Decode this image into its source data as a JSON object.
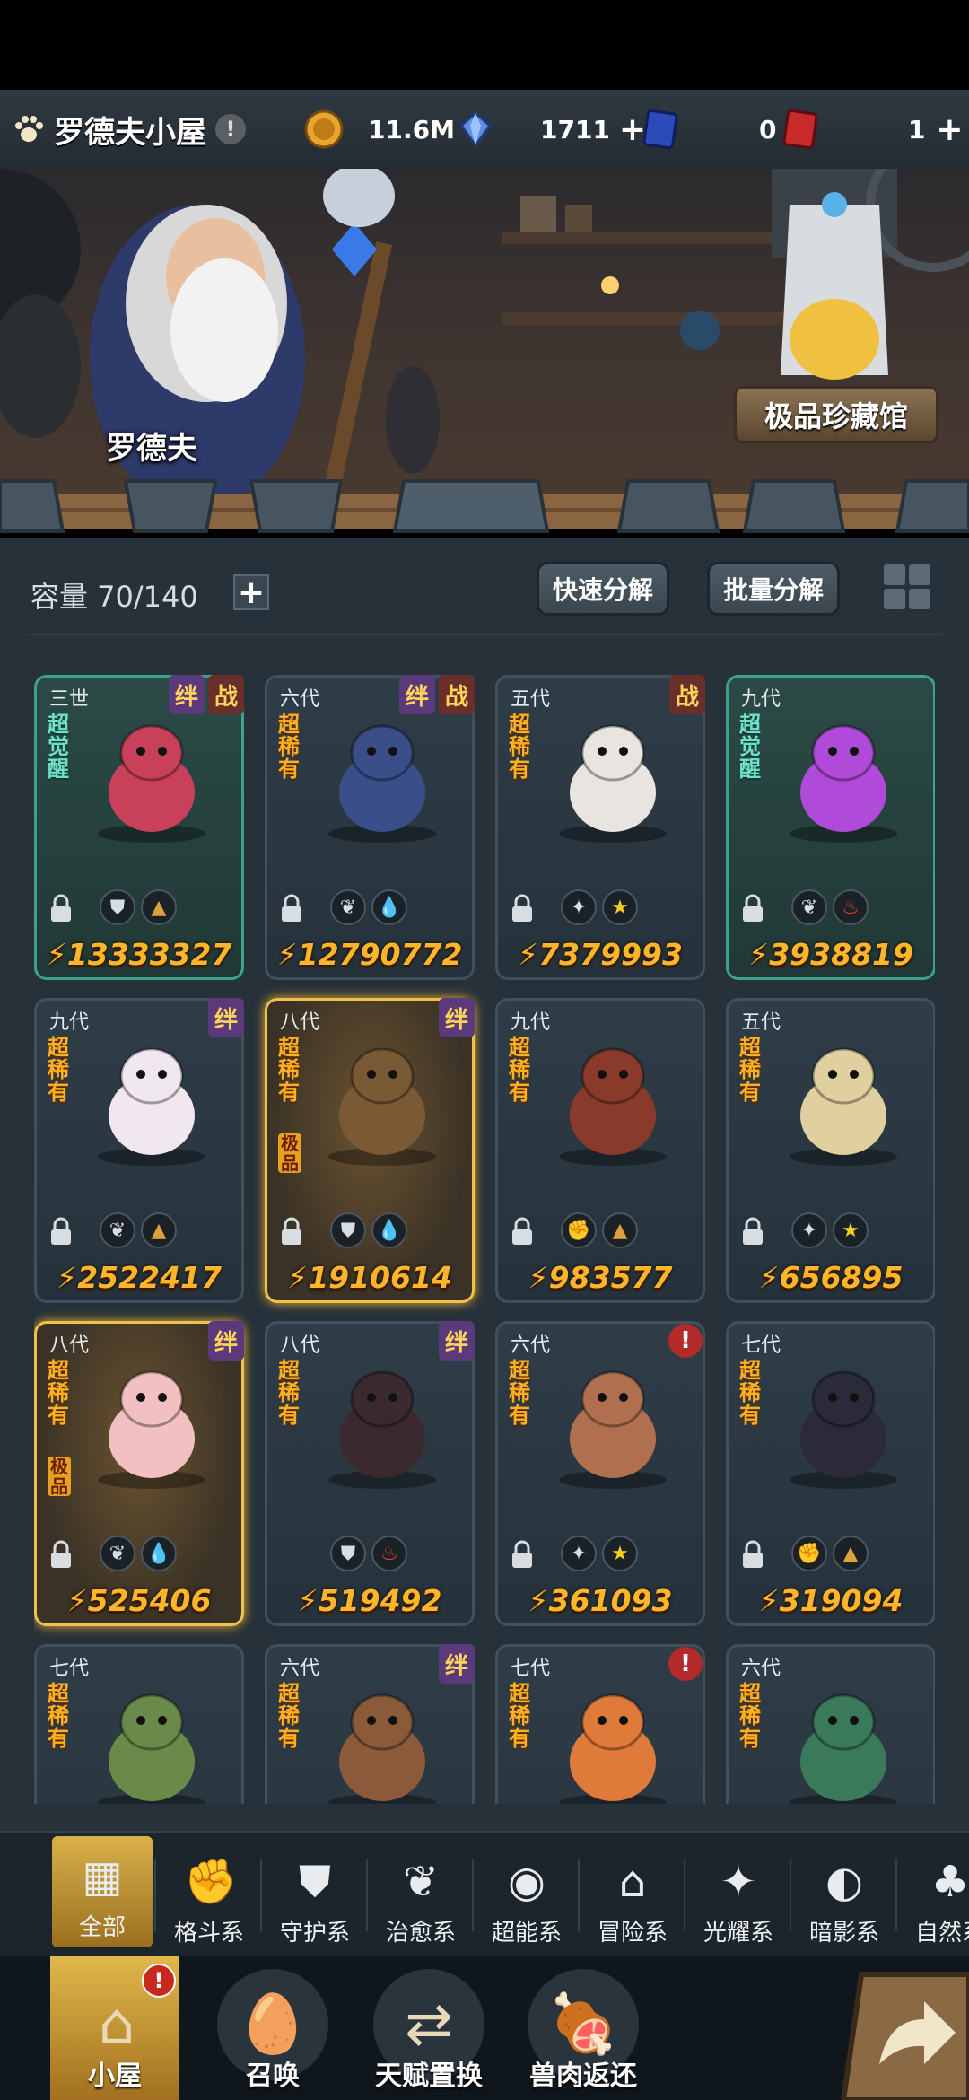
{
  "topbar": {
    "title": "罗德夫小屋",
    "warn": "!",
    "gold": "11.6M",
    "crystal": "1711",
    "ticket_a": "0",
    "ticket_b": "1",
    "plus": "+"
  },
  "scene": {
    "npc_name": "罗德夫",
    "gallery_label": "极品珍藏馆"
  },
  "storage": {
    "capacity_text": "容量 70/140",
    "plus": "+",
    "quick_decompose": "快速分解",
    "batch_decompose": "批量分解"
  },
  "pets": [
    {
      "gen": "三世",
      "rarity": "超觉醒",
      "premium": "",
      "tags": [
        "绊",
        "战"
      ],
      "elements": [
        "guard",
        "adventure"
      ],
      "power": "13333327",
      "style": "awaken",
      "alert": false,
      "locked": true,
      "color": "#c9405a"
    },
    {
      "gen": "六代",
      "rarity": "超稀有",
      "premium": "",
      "tags": [
        "绊",
        "战"
      ],
      "elements": [
        "heal",
        "water"
      ],
      "power": "12790772",
      "style": "normal",
      "alert": false,
      "locked": true,
      "color": "#3a4e8a"
    },
    {
      "gen": "五代",
      "rarity": "超稀有",
      "premium": "",
      "tags": [
        "战"
      ],
      "elements": [
        "light",
        "star"
      ],
      "power": "7379993",
      "style": "normal",
      "alert": false,
      "locked": true,
      "color": "#e8e4e0"
    },
    {
      "gen": "九代",
      "rarity": "超觉醒",
      "premium": "",
      "tags": [],
      "elements": [
        "heal",
        "fire"
      ],
      "power": "3938819",
      "style": "awaken",
      "alert": false,
      "locked": true,
      "color": "#b04ad8"
    },
    {
      "gen": "九代",
      "rarity": "超稀有",
      "premium": "",
      "tags": [
        "绊"
      ],
      "elements": [
        "heal",
        "adventure"
      ],
      "power": "2522417",
      "style": "normal",
      "alert": false,
      "locked": true,
      "color": "#f0e8ee"
    },
    {
      "gen": "八代",
      "rarity": "超稀有",
      "premium": "极品",
      "tags": [
        "绊"
      ],
      "elements": [
        "guard",
        "water"
      ],
      "power": "1910614",
      "style": "gold",
      "alert": false,
      "locked": true,
      "color": "#7a5a34"
    },
    {
      "gen": "九代",
      "rarity": "超稀有",
      "premium": "",
      "tags": [],
      "elements": [
        "fight",
        "adventure"
      ],
      "power": "983577",
      "style": "normal",
      "alert": false,
      "locked": true,
      "color": "#8a3a2a"
    },
    {
      "gen": "五代",
      "rarity": "超稀有",
      "premium": "",
      "tags": [],
      "elements": [
        "light",
        "star"
      ],
      "power": "656895",
      "style": "normal",
      "alert": false,
      "locked": true,
      "color": "#e0d0a0"
    },
    {
      "gen": "八代",
      "rarity": "超稀有",
      "premium": "极品",
      "tags": [
        "绊"
      ],
      "elements": [
        "heal",
        "water"
      ],
      "power": "525406",
      "style": "gold",
      "alert": false,
      "locked": true,
      "color": "#f2c0c0"
    },
    {
      "gen": "八代",
      "rarity": "超稀有",
      "premium": "",
      "tags": [
        "绊"
      ],
      "elements": [
        "guard",
        "fire"
      ],
      "power": "519492",
      "style": "normal",
      "alert": false,
      "locked": false,
      "color": "#3a2a30"
    },
    {
      "gen": "六代",
      "rarity": "超稀有",
      "premium": "",
      "tags": [],
      "elements": [
        "light",
        "star"
      ],
      "power": "361093",
      "style": "normal",
      "alert": true,
      "locked": true,
      "color": "#b07050"
    },
    {
      "gen": "七代",
      "rarity": "超稀有",
      "premium": "",
      "tags": [],
      "elements": [
        "fight",
        "adventure"
      ],
      "power": "319094",
      "style": "normal",
      "alert": false,
      "locked": true,
      "color": "#2a2a3a"
    },
    {
      "gen": "七代",
      "rarity": "超稀有",
      "premium": "",
      "tags": [],
      "elements": [],
      "power": "",
      "style": "normal",
      "alert": false,
      "locked": false,
      "color": "#6a8a4a"
    },
    {
      "gen": "六代",
      "rarity": "超稀有",
      "premium": "",
      "tags": [
        "绊"
      ],
      "elements": [],
      "power": "",
      "style": "normal",
      "alert": false,
      "locked": false,
      "color": "#8a5a3a"
    },
    {
      "gen": "七代",
      "rarity": "超稀有",
      "premium": "",
      "tags": [],
      "elements": [],
      "power": "",
      "style": "normal",
      "alert": true,
      "locked": false,
      "color": "#e07a3a"
    },
    {
      "gen": "六代",
      "rarity": "超稀有",
      "premium": "",
      "tags": [],
      "elements": [],
      "power": "",
      "style": "normal",
      "alert": false,
      "locked": false,
      "color": "#3a7a5a"
    }
  ],
  "alert_mark": "!",
  "categories": [
    {
      "label": "全部",
      "icon": "all-icon"
    },
    {
      "label": "格斗系",
      "icon": "fist-icon"
    },
    {
      "label": "守护系",
      "icon": "shield-icon"
    },
    {
      "label": "治愈系",
      "icon": "sprout-icon"
    },
    {
      "label": "超能系",
      "icon": "psychic-icon"
    },
    {
      "label": "冒险系",
      "icon": "lantern-icon"
    },
    {
      "label": "光耀系",
      "icon": "light-icon"
    },
    {
      "label": "暗影系",
      "icon": "shadow-icon"
    },
    {
      "label": "自然系",
      "icon": "nature-icon"
    }
  ],
  "nav": [
    {
      "label": "小屋",
      "icon": "house-icon",
      "badge": "!"
    },
    {
      "label": "召唤",
      "icon": "egg-icon",
      "badge": ""
    },
    {
      "label": "天赋置换",
      "icon": "swap-icon",
      "badge": ""
    },
    {
      "label": "兽肉返还",
      "icon": "meat-icon",
      "badge": ""
    }
  ],
  "colors": {
    "accent_gold": "#e0b84a",
    "power": "#ffb52a",
    "panel": "#26313a"
  }
}
